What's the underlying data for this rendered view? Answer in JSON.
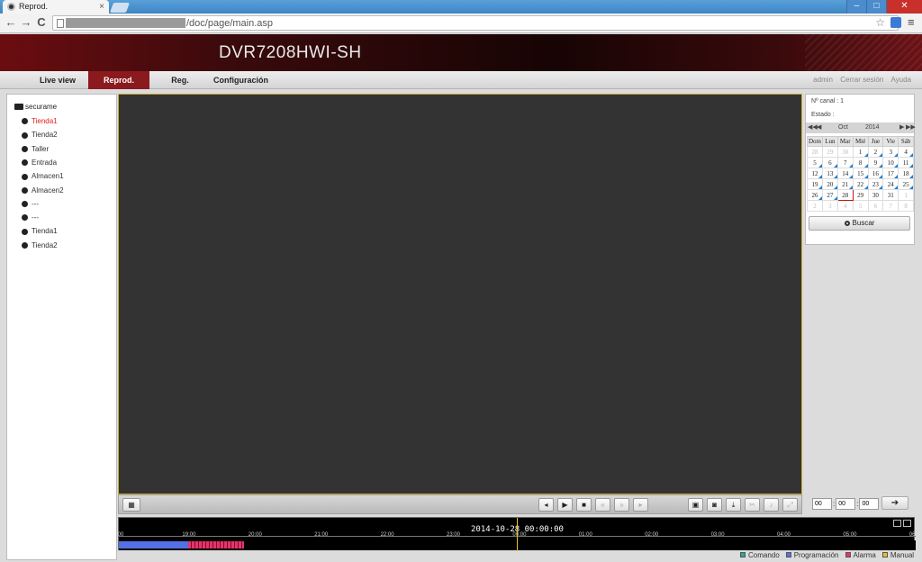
{
  "browser": {
    "tab_title": "Reprod.",
    "tab_close": "×",
    "window_controls": [
      "–",
      "□",
      "✕"
    ],
    "url_path": "/doc/page/main.asp",
    "nav_icons": [
      "back-icon",
      "forward-icon",
      "reload-icon"
    ],
    "glyphs": {
      "back": "←",
      "forward": "→",
      "reload": "C",
      "star": "☆",
      "menu": "≡"
    }
  },
  "header": {
    "title": "DVR7208HWI-SH"
  },
  "nav": {
    "items": [
      {
        "label": "Live view",
        "active": false
      },
      {
        "label": "Reprod.",
        "active": true
      },
      {
        "label": "Reg.",
        "active": false
      },
      {
        "label": "Configuración",
        "active": false
      }
    ],
    "user_links": [
      "admin",
      "Cerrar sesión",
      "Ayuda"
    ]
  },
  "tree": {
    "root": "securame",
    "channels": [
      {
        "label": "Tienda1",
        "active": true
      },
      {
        "label": "Tienda2",
        "active": false
      },
      {
        "label": "Taller",
        "active": false
      },
      {
        "label": "Entrada",
        "active": false
      },
      {
        "label": "Almacen1",
        "active": false
      },
      {
        "label": "Almacen2",
        "active": false
      },
      {
        "label": "---",
        "active": false
      },
      {
        "label": "---",
        "active": false
      },
      {
        "label": "Tienda1",
        "active": false
      },
      {
        "label": "Tienda2",
        "active": false
      }
    ]
  },
  "info": {
    "channel_label": "Nº canal : 1",
    "status_label": "Estado :"
  },
  "calendar": {
    "month": "Oct",
    "year": "2014",
    "weekdays": [
      "Dom",
      "Lun",
      "Mar",
      "Mié",
      "Jue",
      "Vie",
      "Sáb"
    ],
    "weeks": [
      [
        "28",
        "29",
        "30",
        "1",
        "2",
        "3",
        "4"
      ],
      [
        "5",
        "6",
        "7",
        "8",
        "9",
        "10",
        "11"
      ],
      [
        "12",
        "13",
        "14",
        "15",
        "16",
        "17",
        "18"
      ],
      [
        "19",
        "20",
        "21",
        "22",
        "23",
        "24",
        "25"
      ],
      [
        "26",
        "27",
        "28",
        "29",
        "30",
        "31",
        "1"
      ],
      [
        "2",
        "3",
        "4",
        "5",
        "6",
        "7",
        "8"
      ]
    ],
    "selected": "28",
    "search_label": "Buscar"
  },
  "time_inputs": {
    "hh": "00",
    "mm": "00",
    "ss": "00",
    "sep": ":",
    "go": "➔"
  },
  "controls": {
    "layout": "▦",
    "buttons": [
      {
        "name": "prev-frame",
        "glyph": "◂"
      },
      {
        "name": "play",
        "glyph": "▶"
      },
      {
        "name": "stop",
        "glyph": "■"
      },
      {
        "name": "slow",
        "glyph": "«"
      },
      {
        "name": "fast",
        "glyph": "»"
      },
      {
        "name": "next-frame",
        "glyph": "▸"
      }
    ],
    "right_buttons": [
      {
        "name": "stop-all",
        "glyph": "▣"
      },
      {
        "name": "capture",
        "glyph": "◙"
      },
      {
        "name": "download",
        "glyph": "⤓"
      },
      {
        "name": "clip",
        "glyph": "✂"
      },
      {
        "name": "volume",
        "glyph": "♪"
      },
      {
        "name": "fullscreen",
        "glyph": "⤢"
      }
    ]
  },
  "timeline": {
    "datetime": "2014-10-28 00:00:00",
    "hour_labels": [
      ":00",
      "19:00",
      "20:00",
      "21:00",
      "22:00",
      "23:00",
      "00:00",
      "01:00",
      "02:00",
      "03:00",
      "04:00",
      "05:00",
      "06:"
    ],
    "segments": {
      "scheduled": {
        "from_hour": 18,
        "to_hour": 19.05
      },
      "alarm": {
        "from_hour": 19.05,
        "to_hour": 19.9
      }
    }
  },
  "legend": [
    {
      "label": "Comando",
      "color": "#27a8a0"
    },
    {
      "label": "Programación",
      "color": "#5470e4"
    },
    {
      "label": "Alarma",
      "color": "#e8336a"
    },
    {
      "label": "Manual",
      "color": "#e8c21e"
    }
  ],
  "colors": {
    "accent": "#8b1a1e",
    "video_border": "#c9ac2d",
    "record_marker": "#1e7fd0",
    "cursor": "#f0c419"
  }
}
